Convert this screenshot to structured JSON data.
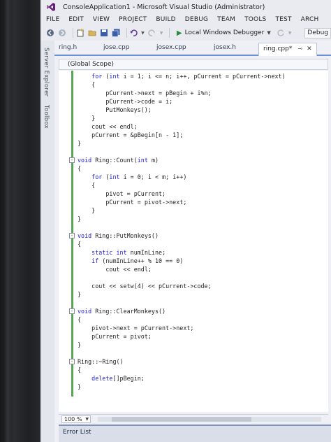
{
  "window": {
    "title": "ConsoleApplication1 - Microsoft Visual Studio (Administrator)"
  },
  "menu": [
    "FILE",
    "EDIT",
    "VIEW",
    "PROJECT",
    "BUILD",
    "DEBUG",
    "TEAM",
    "TOOLS",
    "TEST",
    "ARCH"
  ],
  "toolbar": {
    "debugger_label": "Local Windows Debugger",
    "config_label": "Debug"
  },
  "side_panel": {
    "server_explorer": "Server Explorer",
    "toolbox": "Toolbox"
  },
  "tabs": [
    {
      "label": "ring.h",
      "active": false
    },
    {
      "label": "jose.cpp",
      "active": false
    },
    {
      "label": "josex.cpp",
      "active": false
    },
    {
      "label": "josex.h",
      "active": false
    },
    {
      "label": "ring.cpp*",
      "active": true
    }
  ],
  "scope": "(Global Scope)",
  "code_lines": [
    {
      "text": "    for (int i = 1; i <= n; i++, pCurrent = pCurrent->next)",
      "fold": ""
    },
    {
      "text": "    {",
      "fold": ""
    },
    {
      "text": "        pCurrent->next = pBegin + i%n;",
      "fold": ""
    },
    {
      "text": "        pCurrent->code = i;",
      "fold": ""
    },
    {
      "text": "        PutMonkeys();",
      "fold": ""
    },
    {
      "text": "    }",
      "fold": ""
    },
    {
      "text": "    cout << endl;",
      "fold": ""
    },
    {
      "text": "    pCurrent = &pBegin[n - 1];",
      "fold": ""
    },
    {
      "text": "}",
      "fold": ""
    },
    {
      "text": "",
      "fold": ""
    },
    {
      "text": "void Ring::Count(int m)",
      "fold": "-"
    },
    {
      "text": "{",
      "fold": ""
    },
    {
      "text": "    for (int i = 0; i < m; i++)",
      "fold": ""
    },
    {
      "text": "    {",
      "fold": ""
    },
    {
      "text": "        pivot = pCurrent;",
      "fold": ""
    },
    {
      "text": "        pCurrent = pivot->next;",
      "fold": ""
    },
    {
      "text": "    }",
      "fold": ""
    },
    {
      "text": "}",
      "fold": ""
    },
    {
      "text": "",
      "fold": ""
    },
    {
      "text": "void Ring::PutMonkeys()",
      "fold": "-"
    },
    {
      "text": "{",
      "fold": ""
    },
    {
      "text": "    static int numInLine;",
      "fold": ""
    },
    {
      "text": "    if (numInLine++ % 10 == 0)",
      "fold": ""
    },
    {
      "text": "        cout << endl;",
      "fold": ""
    },
    {
      "text": "",
      "fold": ""
    },
    {
      "text": "    cout << setw(4) << pCurrent->code;",
      "fold": ""
    },
    {
      "text": "}",
      "fold": ""
    },
    {
      "text": "",
      "fold": ""
    },
    {
      "text": "void Ring::ClearMonkeys()",
      "fold": "-"
    },
    {
      "text": "{",
      "fold": ""
    },
    {
      "text": "    pivot->next = pCurrent->next;",
      "fold": ""
    },
    {
      "text": "    pCurrent = pivot;",
      "fold": ""
    },
    {
      "text": "}",
      "fold": ""
    },
    {
      "text": "",
      "fold": ""
    },
    {
      "text": "Ring::~Ring()",
      "fold": "-"
    },
    {
      "text": "{",
      "fold": ""
    },
    {
      "text": "    delete[]pBegin;",
      "fold": ""
    },
    {
      "text": "}",
      "fold": ""
    }
  ],
  "keywords": [
    "for",
    "int",
    "void",
    "static",
    "if",
    "delete"
  ],
  "zoom": "100 %",
  "error_list": "Error List",
  "colors": {
    "keyword": "#1a1ad6",
    "change_bar": "#58a755",
    "tab_accent": "#6b8fd6"
  }
}
